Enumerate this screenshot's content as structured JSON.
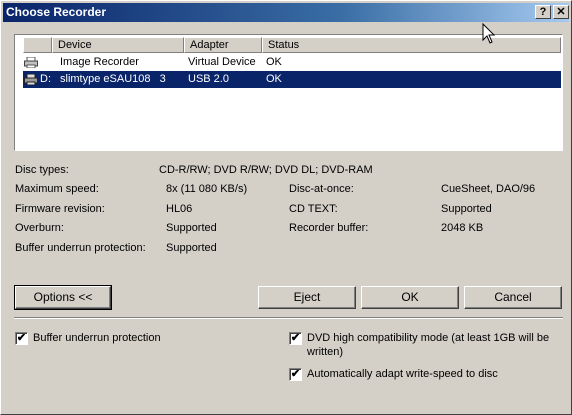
{
  "window": {
    "title": "Choose Recorder",
    "help_label": "?",
    "close_label": "✕"
  },
  "list": {
    "columns": [
      "Device",
      "Adapter",
      "Status"
    ],
    "rows": [
      {
        "letter": "",
        "device": "Image Recorder",
        "adapter": "Virtual Device",
        "status": "OK",
        "icon": "printer-icon",
        "selected": false
      },
      {
        "letter": "D:",
        "device": "slimtype eSAU108   3",
        "adapter": "USB 2.0",
        "status": "OK",
        "icon": "drive-icon",
        "selected": true
      }
    ]
  },
  "info": {
    "disc_types_label": "Disc types:",
    "disc_types_value": "CD-R/RW; DVD R/RW; DVD DL; DVD-RAM",
    "max_speed_label": "Maximum speed:",
    "max_speed_value": "8x (11 080 KB/s)",
    "firmware_label": "Firmware revision:",
    "firmware_value": "HL06",
    "overburn_label": "Overburn:",
    "overburn_value": "Supported",
    "bup_label": "Buffer underrun protection:",
    "bup_value": "Supported",
    "dao_label": "Disc-at-once:",
    "dao_value": "CueSheet, DAO/96",
    "cdtext_label": "CD TEXT:",
    "cdtext_value": "Supported",
    "buffer_label": "Recorder buffer:",
    "buffer_value": "2048 KB"
  },
  "buttons": {
    "options": "Options <<",
    "eject": "Eject",
    "ok": "OK",
    "cancel": "Cancel"
  },
  "options": {
    "buffer_underrun": {
      "label": "Buffer underrun protection",
      "checked": true
    },
    "dvd_compat": {
      "label_line1": "DVD high compatibility mode (at least 1GB will be",
      "label_line2": "written)",
      "checked": true
    },
    "adapt_speed": {
      "label": "Automatically adapt write-speed to disc",
      "checked": true
    }
  },
  "check_mark": "✔"
}
